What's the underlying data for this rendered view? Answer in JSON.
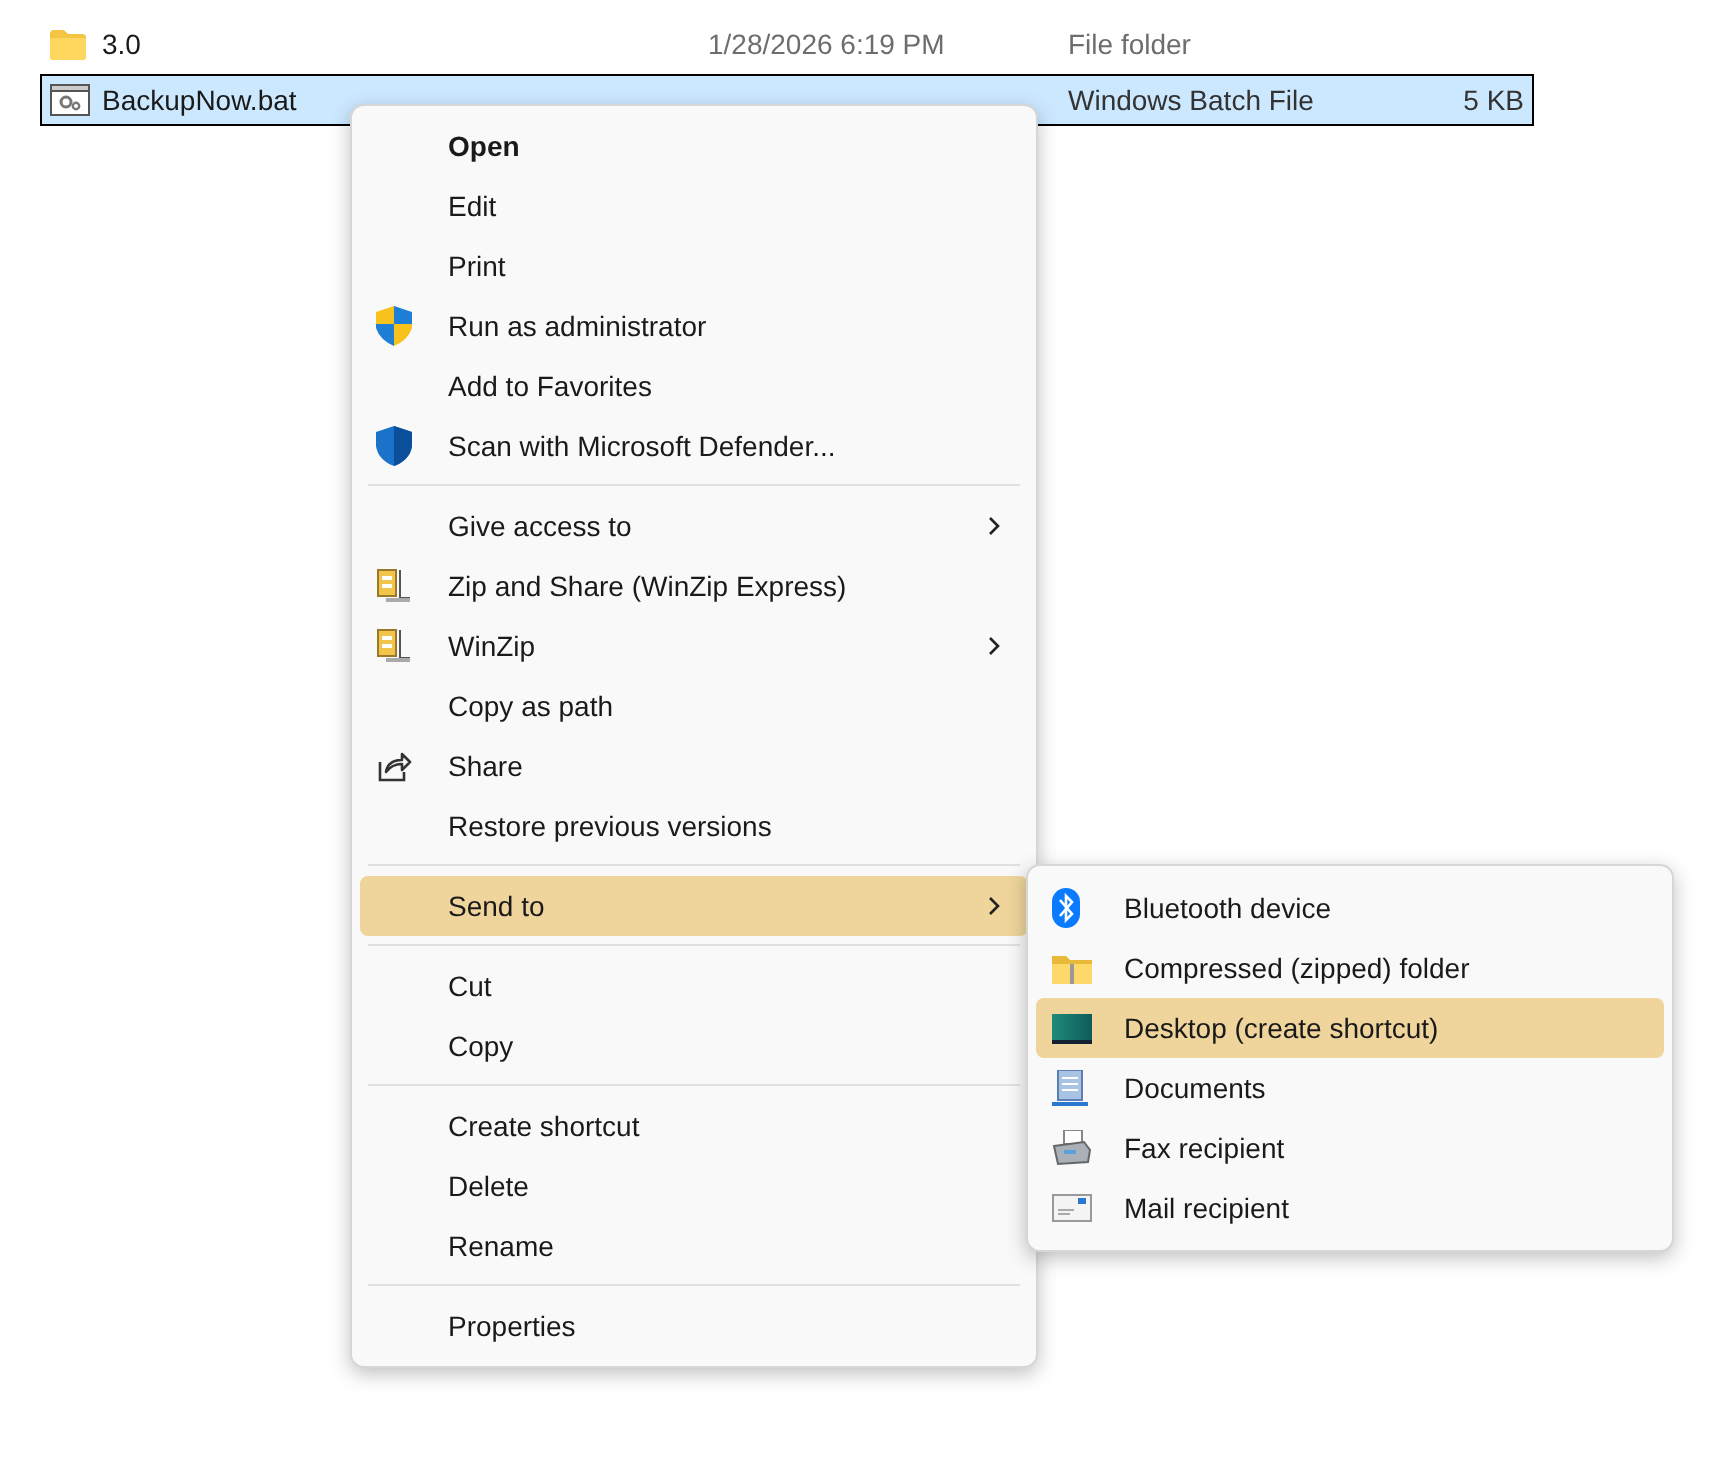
{
  "files": [
    {
      "name": "3.0",
      "kind": "folder",
      "modified": "1/28/2026 6:19 PM",
      "type": "File folder",
      "selected": false
    },
    {
      "name": "BackupNow.bat",
      "kind": "batch",
      "type": "Windows Batch File",
      "size": "5 KB",
      "selected": true
    }
  ],
  "context_menu": {
    "sections": [
      [
        {
          "label": "Open",
          "default": true,
          "submenu": false,
          "selected": false
        },
        {
          "label": "Edit",
          "default": false,
          "submenu": false,
          "selected": false
        },
        {
          "label": "Print",
          "default": false,
          "submenu": false,
          "selected": false
        },
        {
          "label": "Run as administrator",
          "default": false,
          "submenu": false,
          "selected": false
        },
        {
          "label": "Add to Favorites",
          "default": false,
          "submenu": false,
          "selected": false
        },
        {
          "label": "Scan with Microsoft Defender...",
          "default": false,
          "submenu": false,
          "selected": false
        }
      ],
      [
        {
          "label": "Give access to",
          "default": false,
          "submenu": true,
          "selected": false
        },
        {
          "label": "Zip and Share (WinZip Express)",
          "default": false,
          "submenu": false,
          "selected": false
        },
        {
          "label": "WinZip",
          "default": false,
          "submenu": true,
          "selected": false
        },
        {
          "label": "Copy as path",
          "default": false,
          "submenu": false,
          "selected": false
        },
        {
          "label": "Share",
          "default": false,
          "submenu": false,
          "selected": false
        },
        {
          "label": "Restore previous versions",
          "default": false,
          "submenu": false,
          "selected": false
        }
      ],
      [
        {
          "label": "Send to",
          "default": false,
          "submenu": true,
          "selected": true
        }
      ],
      [
        {
          "label": "Cut",
          "default": false,
          "submenu": false,
          "selected": false
        },
        {
          "label": "Copy",
          "default": false,
          "submenu": false,
          "selected": false
        }
      ],
      [
        {
          "label": "Create shortcut",
          "default": false,
          "submenu": false,
          "selected": false
        },
        {
          "label": "Delete",
          "default": false,
          "submenu": false,
          "selected": false
        },
        {
          "label": "Rename",
          "default": false,
          "submenu": false,
          "selected": false
        }
      ],
      [
        {
          "label": "Properties",
          "default": false,
          "submenu": false,
          "selected": false
        }
      ]
    ]
  },
  "send_to_menu": {
    "items": [
      {
        "label": "Bluetooth device",
        "selected": false
      },
      {
        "label": "Compressed (zipped) folder",
        "selected": false
      },
      {
        "label": "Desktop (create shortcut)",
        "selected": true
      },
      {
        "label": "Documents",
        "selected": false
      },
      {
        "label": "Fax recipient",
        "selected": false
      },
      {
        "label": "Mail recipient",
        "selected": false
      }
    ]
  }
}
